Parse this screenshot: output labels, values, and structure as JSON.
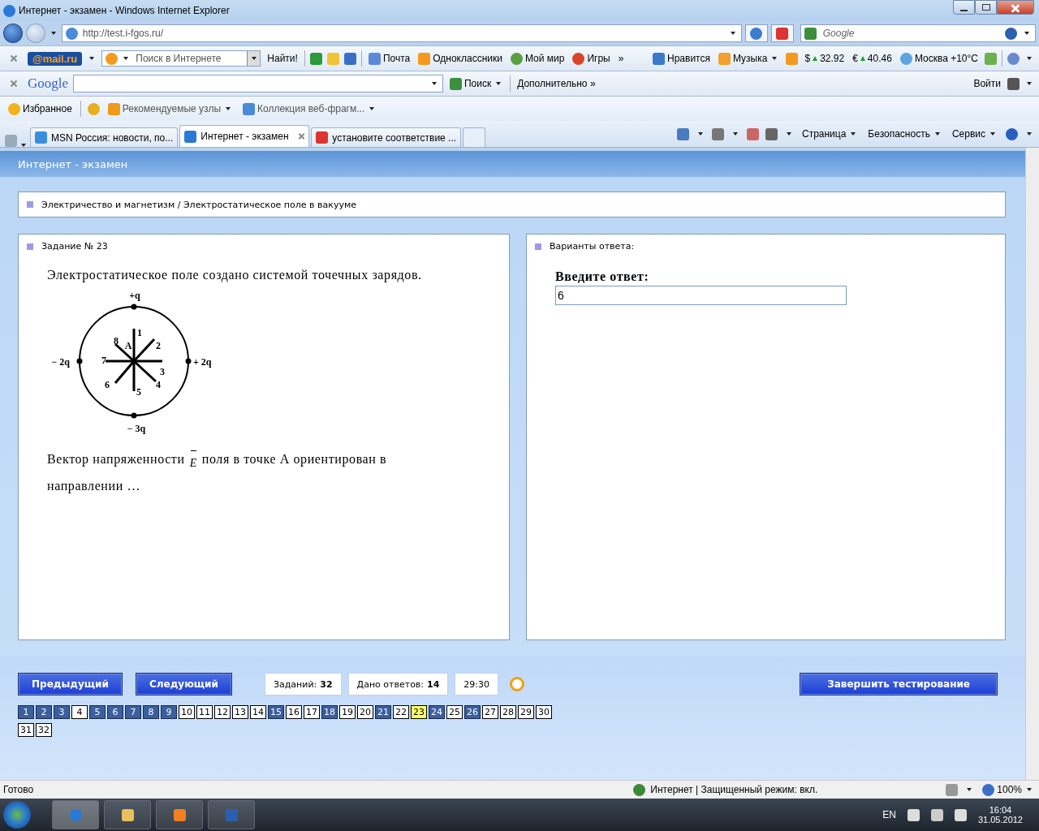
{
  "window": {
    "title": "Интернет - экзамен - Windows Internet Explorer"
  },
  "address_bar": {
    "url": "http://test.i-fgos.ru/"
  },
  "search_box": {
    "placeholder": "Google"
  },
  "mail_toolbar": {
    "logo": "@mail.ru",
    "search_placeholder": "Поиск в Интернете",
    "find_button": "Найти!",
    "links": [
      {
        "label": "Почта"
      },
      {
        "label": "Одноклассники"
      },
      {
        "label": "Мой мир"
      },
      {
        "label": "Игры"
      }
    ],
    "more": "»",
    "widgets": [
      {
        "label": "Нравится",
        "kind": "link"
      },
      {
        "label": "Музыка",
        "kind": "menu"
      },
      {
        "label": "$",
        "kind": "currency",
        "value": "32.92"
      },
      {
        "label": "€",
        "kind": "currency",
        "value": "40.46"
      },
      {
        "label": "Москва +10°C",
        "kind": "weather"
      }
    ]
  },
  "google_toolbar": {
    "logo": "Google",
    "search_button": "Поиск",
    "more": "Дополнительно",
    "more_glyph": "»",
    "login": "Войти"
  },
  "favorites_bar": {
    "favorites": "Избранное",
    "items": [
      {
        "label": "Рекомендуемые узлы"
      },
      {
        "label": "Коллекция веб-фрагм..."
      }
    ]
  },
  "tabs": [
    {
      "label": "MSN Россия: новости, по...",
      "selected": false
    },
    {
      "label": "Интернет - экзамен",
      "selected": true
    },
    {
      "label": "установите соответствие ...",
      "selected": false
    }
  ],
  "command_bar": {
    "menus": [
      "Страница",
      "Безопасность",
      "Сервис"
    ]
  },
  "page": {
    "header": "Интернет - экзамен",
    "breadcrumb": "Электричество и магнетизм / Электростатическое поле в вакууме",
    "task": {
      "title": "Задание № 23",
      "question": "Электростатическое поле создано системой точечных зарядов.",
      "charges": [
        {
          "label": "+q",
          "kind": "top"
        },
        {
          "label": "− 2q",
          "kind": "left"
        },
        {
          "label": "+ 2q",
          "kind": "right"
        },
        {
          "label": "− 3q",
          "kind": "bottom"
        }
      ],
      "directions": [
        "1",
        "2",
        "3",
        "4",
        "5",
        "6",
        "7",
        "8"
      ],
      "point": "A",
      "question_before": "Вектор напряженности",
      "vector": "E",
      "question_after": "поля в точке А ориентирован в направлении …"
    },
    "answer": {
      "title": "Варианты ответа:",
      "prompt": "Введите ответ:",
      "value": "6"
    },
    "controls": {
      "prev": "Предыдущий",
      "next": "Следующий",
      "counters": [
        {
          "label": "Заданий:",
          "value": "32"
        },
        {
          "label": "Дано ответов:",
          "value": "14"
        }
      ],
      "timer": "29:30",
      "finish": "Завершить тестирование"
    },
    "questions": [
      {
        "label": "1",
        "answered": true,
        "selected": false
      },
      {
        "label": "2",
        "answered": true,
        "selected": false
      },
      {
        "label": "3",
        "answered": true,
        "selected": false
      },
      {
        "label": "4",
        "answered": false,
        "selected": false
      },
      {
        "label": "5",
        "answered": true,
        "selected": false
      },
      {
        "label": "6",
        "answered": true,
        "selected": false
      },
      {
        "label": "7",
        "answered": true,
        "selected": false
      },
      {
        "label": "8",
        "answered": true,
        "selected": false
      },
      {
        "label": "9",
        "answered": true,
        "selected": false
      },
      {
        "label": "10",
        "answered": false,
        "selected": false
      },
      {
        "label": "11",
        "answered": false,
        "selected": false
      },
      {
        "label": "12",
        "answered": false,
        "selected": false
      },
      {
        "label": "13",
        "answered": false,
        "selected": false
      },
      {
        "label": "14",
        "answered": false,
        "selected": false
      },
      {
        "label": "15",
        "answered": true,
        "selected": false
      },
      {
        "label": "16",
        "answered": false,
        "selected": false
      },
      {
        "label": "17",
        "answered": false,
        "selected": false
      },
      {
        "label": "18",
        "answered": true,
        "selected": false
      },
      {
        "label": "19",
        "answered": false,
        "selected": false
      },
      {
        "label": "20",
        "answered": false,
        "selected": false
      },
      {
        "label": "21",
        "answered": true,
        "selected": false
      },
      {
        "label": "22",
        "answered": false,
        "selected": false
      },
      {
        "label": "23",
        "answered": false,
        "selected": true
      },
      {
        "label": "24",
        "answered": true,
        "selected": false
      },
      {
        "label": "25",
        "answered": false,
        "selected": false
      },
      {
        "label": "26",
        "answered": true,
        "selected": false
      },
      {
        "label": "27",
        "answered": false,
        "selected": false
      },
      {
        "label": "28",
        "answered": false,
        "selected": false
      },
      {
        "label": "29",
        "answered": false,
        "selected": false
      },
      {
        "label": "30",
        "answered": false,
        "selected": false
      },
      {
        "label": "31",
        "answered": false,
        "selected": false
      },
      {
        "label": "32",
        "answered": false,
        "selected": false
      }
    ]
  },
  "status_bar": {
    "text": "Готово",
    "zone": "Интернет | Защищенный режим: вкл.",
    "zoom": "100%"
  },
  "taskbar": {
    "language": "EN",
    "time": "16:04",
    "date": "31.05.2012"
  }
}
